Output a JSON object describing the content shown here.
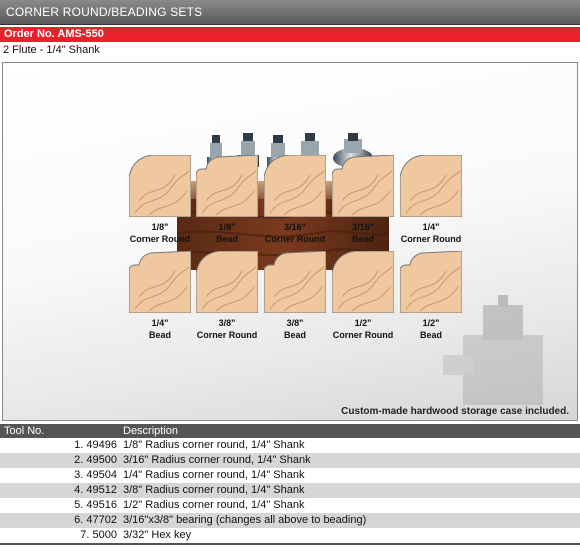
{
  "header": {
    "title": "CORNER ROUND/BEADING SETS"
  },
  "order": {
    "label": "Order No. AMS-550"
  },
  "subtitle": "2 Flute - 1/4\" Shank",
  "profiles": [
    {
      "size": "1/8\"",
      "type": "Corner Round"
    },
    {
      "size": "1/8\"",
      "type": "Bead"
    },
    {
      "size": "3/16\"",
      "type": "Corner Round"
    },
    {
      "size": "3/16\"",
      "type": "Bead"
    },
    {
      "size": "1/4\"",
      "type": "Corner Round"
    },
    {
      "size": "1/4\"",
      "type": "Bead"
    },
    {
      "size": "3/8\"",
      "type": "Corner Round"
    },
    {
      "size": "3/8\"",
      "type": "Bead"
    },
    {
      "size": "1/2\"",
      "type": "Corner Round"
    },
    {
      "size": "1/2\"",
      "type": "Bead"
    }
  ],
  "case_note": "Custom-made hardwood storage case included.",
  "table": {
    "headers": [
      "Tool No.",
      "Description"
    ],
    "rows": [
      {
        "tool": "1. 49496",
        "desc": "1/8\" Radius corner round, 1/4\" Shank"
      },
      {
        "tool": "2. 49500",
        "desc": "3/16\" Radius corner round, 1/4\" Shank"
      },
      {
        "tool": "3. 49504",
        "desc": "1/4\" Radius corner round, 1/4\" Shank"
      },
      {
        "tool": "4. 49512",
        "desc": "3/8\" Radius corner round, 1/4\" Shank"
      },
      {
        "tool": "5. 49516",
        "desc": "1/2\" Radius corner round, 1/4\" Shank"
      },
      {
        "tool": "6. 47702",
        "desc": "3/16\"x3/8\" bearing (changes all above to beading)"
      },
      {
        "tool": "7. 5000",
        "desc": "3/32\" Hex key"
      }
    ]
  },
  "colors": {
    "accent": "#e8212b",
    "header": "#5a5a5a",
    "wood": "#f0c8a0"
  }
}
